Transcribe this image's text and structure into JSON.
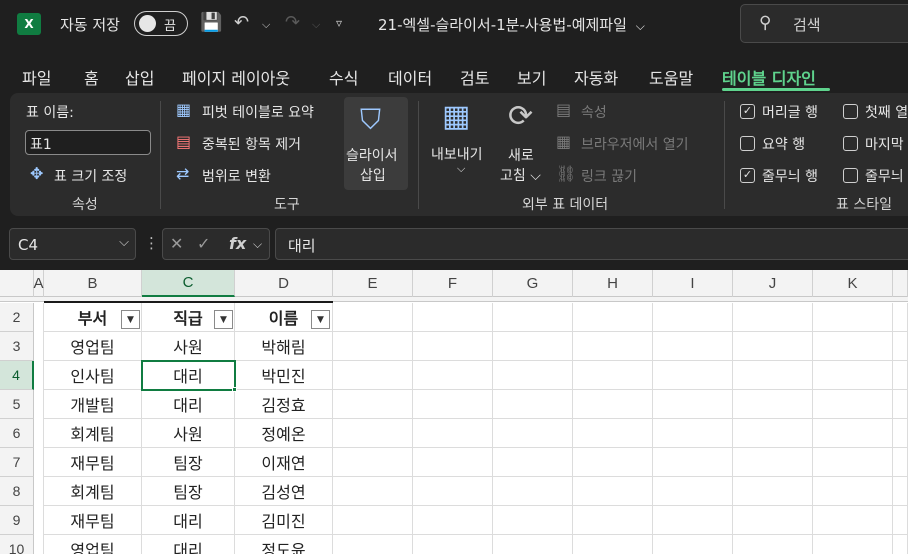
{
  "titlebar": {
    "logo": "X",
    "autosave_label": "자동 저장",
    "autosave_state": "끔",
    "doc_title": "21-엑셀-슬라이서-1분-사용법-예제파일",
    "doc_caret": "⌵",
    "search_placeholder": "검색"
  },
  "menu": {
    "tabs": [
      "파일",
      "홈",
      "삽입",
      "페이지 레이아웃",
      "수식",
      "데이터",
      "검토",
      "보기",
      "자동화",
      "도움말",
      "테이블 디자인"
    ],
    "active_index": 10
  },
  "ribbon": {
    "props": {
      "table_name_label": "표 이름:",
      "table_name_value": "표1",
      "resize_label": "표 크기 조정",
      "group_label": "속성"
    },
    "tools": {
      "pivot_label": "피벗 테이블로 요약",
      "remove_dup_label": "중복된 항목 제거",
      "convert_label": "범위로 변환",
      "slicer_line1": "슬라이서",
      "slicer_line2": "삽입",
      "group_label": "도구"
    },
    "external": {
      "export_label": "내보내기",
      "export_caret": "⌵",
      "refresh_line1": "새로",
      "refresh_line2": "고침 ⌵",
      "properties_label": "속성",
      "open_browser_label": "브라우저에서 열기",
      "unlink_label": "링크 끊기",
      "group_label": "외부 표 데이터"
    },
    "style_options": {
      "header_row": {
        "label": "머리글 행",
        "checked": true
      },
      "total_row": {
        "label": "요약 행",
        "checked": false
      },
      "banded_rows": {
        "label": "줄무늬 행",
        "checked": true
      },
      "first_col": {
        "label": "첫째 열",
        "checked": false
      },
      "last_col": {
        "label": "마지막",
        "checked": false
      },
      "banded_cols": {
        "label": "줄무늬",
        "checked": false
      },
      "group_label": "표 스타일"
    }
  },
  "formulabar": {
    "namebox": "C4",
    "formula": "대리"
  },
  "grid": {
    "columns": [
      "A",
      "B",
      "C",
      "D",
      "E",
      "F",
      "G",
      "H",
      "I",
      "J",
      "K"
    ],
    "selected_column": "C",
    "row_numbers": [
      "2",
      "3",
      "4",
      "5",
      "6",
      "7",
      "8",
      "9",
      "10"
    ],
    "selected_row": "4",
    "table_headers": [
      "부서",
      "직급",
      "이름"
    ],
    "table_rows": [
      [
        "영업팀",
        "사원",
        "박해림"
      ],
      [
        "인사팀",
        "대리",
        "박민진"
      ],
      [
        "개발팀",
        "대리",
        "김정효"
      ],
      [
        "회계팀",
        "사원",
        "정예온"
      ],
      [
        "재무팀",
        "팀장",
        "이재연"
      ],
      [
        "회계팀",
        "팀장",
        "김성연"
      ],
      [
        "재무팀",
        "대리",
        "김미진"
      ],
      [
        "영업팀",
        "대리",
        "정도윤"
      ]
    ]
  }
}
